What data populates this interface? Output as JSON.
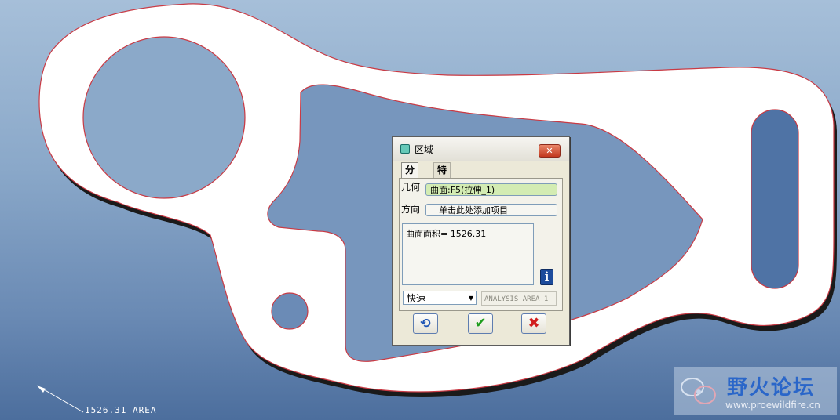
{
  "viewport": {
    "area_annotation": "1526.31 AREA",
    "colors": {
      "part_fill": "#ffffff",
      "part_edge": "#c93a44",
      "shadow": "#1a1a1a"
    }
  },
  "dialog": {
    "title": "区域",
    "tabs": [
      "分析",
      "特征"
    ],
    "active_tab": "分析",
    "geometry_label": "几何",
    "geometry_value": "曲面:F5(拉伸_1)",
    "direction_label": "方向",
    "direction_value": "单击此处添加项目",
    "result_text": "曲面面积= 1526.31",
    "mode_value": "快速",
    "analysis_name": "ANALYSIS_AREA_1",
    "icons": {
      "info": "info-icon",
      "repeat": "repeat-icon",
      "ok": "checkmark-icon",
      "cancel": "x-icon",
      "close": "close-icon"
    }
  },
  "watermark": {
    "name": "野火论坛",
    "url": "www.proewildfire.cn"
  }
}
